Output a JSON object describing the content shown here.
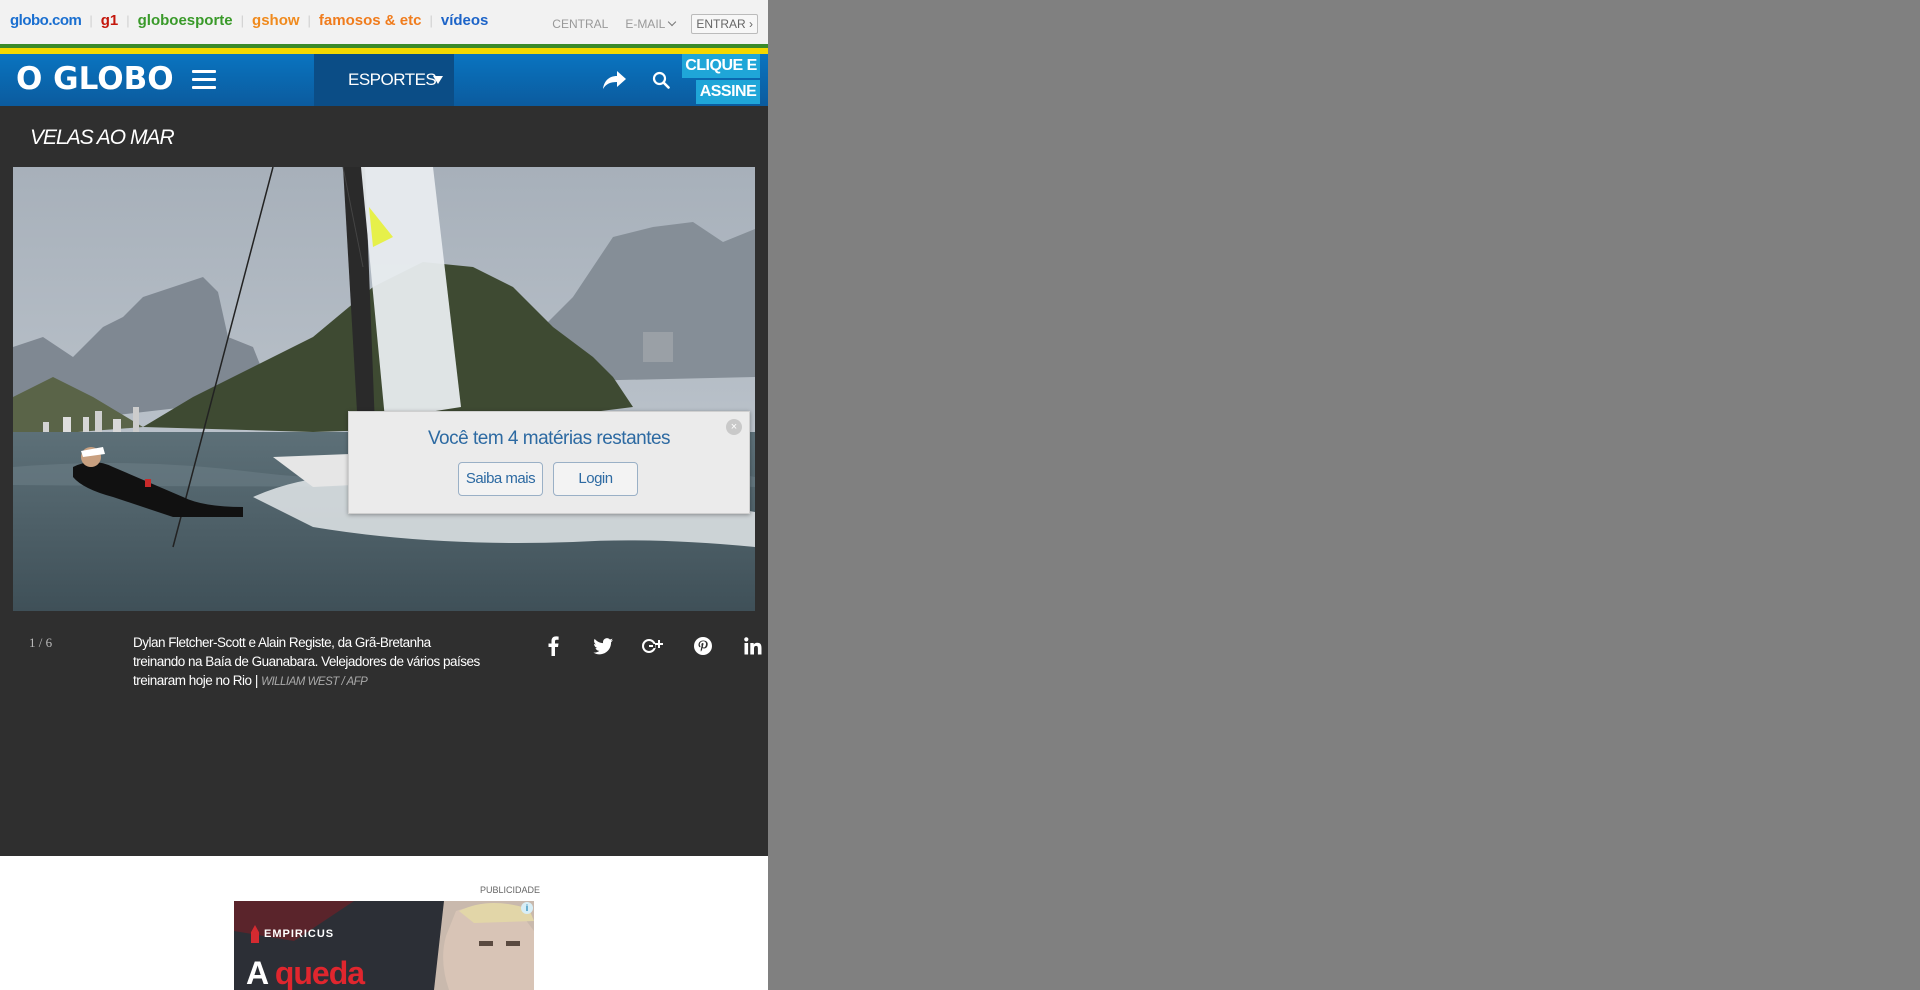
{
  "globobar": {
    "links": [
      {
        "label": "globo.com",
        "color": "#1a6fd0"
      },
      {
        "label": "g1",
        "color": "#c4170c"
      },
      {
        "label": "globoesporte",
        "color": "#3a9a2a"
      },
      {
        "label": "gshow",
        "color": "#f08a1d"
      },
      {
        "label": "famosos & etc",
        "color": "#f07c1d"
      },
      {
        "label": "vídeos",
        "color": "#1d64c8"
      }
    ],
    "central": "CENTRAL",
    "email": "E-MAIL",
    "entrar": "ENTRAR ›"
  },
  "header": {
    "logo": "O GLOBO",
    "menu_icon": "hamburger-icon",
    "section": "ESPORTES",
    "share_icon": "share-icon",
    "search_icon": "search-icon",
    "assine_line1": "CLIQUE E",
    "assine_line2": "ASSINE",
    "brand_color": "#0b5b9e"
  },
  "gallery": {
    "title": "VELAS AO MAR",
    "counter": "1 / 6",
    "caption": "Dylan Fletcher-Scott e Alain Registe, da Grã-Bretanha treinando na Baía de Guanabara. Velejadores de vários países treinaram hoje no Rio |",
    "credit": "WILLIAM WEST / AFP",
    "social_icons": [
      "facebook-icon",
      "twitter-icon",
      "google-plus-icon",
      "pinterest-icon",
      "linkedin-icon"
    ]
  },
  "paywall": {
    "message": "Você tem 4 matérias restantes",
    "saiba_mais": "Saiba mais",
    "login": "Login",
    "close": "×"
  },
  "ad": {
    "label": "PUBLICIDADE",
    "brand": "EMPIRICUS",
    "headline_word1": "A",
    "headline_word2": "queda",
    "info": "i"
  }
}
